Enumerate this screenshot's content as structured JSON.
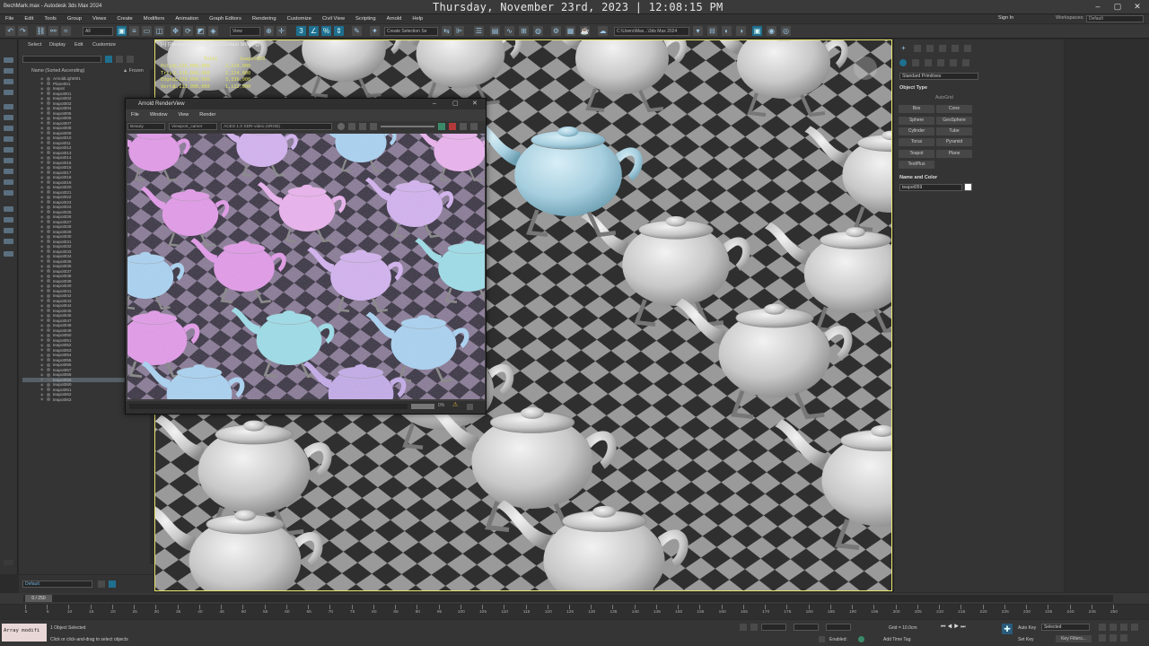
{
  "window": {
    "title": "BechMark.max - Autodesk 3ds Max 2024",
    "clock": "Thursday, November 23rd, 2023 | 12:08:15 PM"
  },
  "menubar": [
    "File",
    "Edit",
    "Tools",
    "Group",
    "Views",
    "Create",
    "Modifiers",
    "Animation",
    "Graph Editors",
    "Rendering",
    "Customize",
    "Civil View",
    "Scripting",
    "Arnold",
    "Help"
  ],
  "account": {
    "sign_in": "Sign In",
    "workspaces_label": "Workspaces:",
    "workspace": "Default"
  },
  "toolbar": {
    "filter": "All",
    "view": "View",
    "selection_set": "Create Selection Se",
    "path": "C:\\Users\\Max...\\3ds Max 2024"
  },
  "explorer": {
    "tabs": [
      "Select",
      "Display",
      "Edit",
      "Customize"
    ],
    "header_name": "Name (Sorted Ascending)",
    "header_frozen": "▲ Frozen",
    "items": [
      "ArnoldLight001",
      "Plane001",
      "teapot",
      "teapot001",
      "teapot002",
      "teapot003",
      "teapot004",
      "teapot005",
      "teapot006",
      "teapot007",
      "teapot008",
      "teapot009",
      "teapot010",
      "teapot011",
      "teapot012",
      "teapot013",
      "teapot014",
      "teapot015",
      "teapot016",
      "teapot017",
      "teapot018",
      "teapot019",
      "teapot020",
      "teapot021",
      "teapot022",
      "teapot023",
      "teapot024",
      "teapot025",
      "teapot026",
      "teapot027",
      "teapot028",
      "teapot029",
      "teapot030",
      "teapot031",
      "teapot032",
      "teapot033",
      "teapot034",
      "teapot035",
      "teapot036",
      "teapot037",
      "teapot038",
      "teapot039",
      "teapot040",
      "teapot041",
      "teapot042",
      "teapot043",
      "teapot044",
      "teapot045",
      "teapot046",
      "teapot047",
      "teapot048",
      "teapot049",
      "teapot050",
      "teapot051",
      "teapot052",
      "teapot053",
      "teapot054",
      "teapot055",
      "teapot056",
      "teapot057",
      "teapot058",
      "teapot059",
      "teapot060",
      "teapot061",
      "teapot062",
      "teapot063"
    ],
    "selected_item": "teapot059",
    "layer": "Default"
  },
  "viewport": {
    "label": "[+] [Perspective] [Standard] [Default Shading]",
    "stats": {
      "header": [
        "Total",
        "teapot059"
      ],
      "polys": [
        "Polys:",
        "2,226,000,000",
        "2,224,000"
      ],
      "tris": [
        "Tris:",
        "2,226,000,000",
        "2,224,000"
      ],
      "edges": [
        "Edges:",
        "3,338,000,000",
        "3,336,000"
      ],
      "verts": [
        "Verts:",
        "1,113,000,000",
        "1,112,000"
      ]
    }
  },
  "render_view": {
    "title": "Arnold RenderView",
    "menu": [
      "File",
      "Window",
      "View",
      "Render"
    ],
    "pass": "Beauty",
    "camera": "Viewport_camer",
    "view_transform": "ACES 1.0 SDR-video (sRGB)",
    "zoom": "0%"
  },
  "command_panel": {
    "dropdown": "Standard Primitives",
    "object_type_title": "Object Type",
    "autogrid": "AutoGrid",
    "buttons": [
      "Box",
      "Cone",
      "Sphere",
      "GeoSphere",
      "Cylinder",
      "Tube",
      "Torus",
      "Pyramid",
      "Teapot",
      "Plane",
      "TextPlus"
    ],
    "name_color_title": "Name and Color",
    "object_name": "teapot059"
  },
  "timeline": {
    "frame": "0 / 250",
    "ticks": [
      "0",
      "5",
      "10",
      "15",
      "20",
      "25",
      "30",
      "35",
      "40",
      "45",
      "50",
      "55",
      "60",
      "65",
      "70",
      "75",
      "80",
      "85",
      "90",
      "95",
      "100",
      "105",
      "110",
      "115",
      "120",
      "125",
      "130",
      "135",
      "140",
      "145",
      "150",
      "155",
      "160",
      "165",
      "170",
      "175",
      "180",
      "185",
      "190",
      "195",
      "200",
      "205",
      "210",
      "215",
      "220",
      "225",
      "230",
      "235",
      "240",
      "245",
      "250"
    ]
  },
  "status": {
    "maxscript": "Array modifi",
    "selected": "1 Object Selected",
    "prompt": "Click or click-and-drag to select objects",
    "grid": "Grid = 10.0cm",
    "enabled": "Enabled:",
    "add_time_tag": "Add Time Tag",
    "auto_key": "Auto Key",
    "set_key": "Set Key",
    "selected_dd": "Selected",
    "key_filters": "Key Filters..."
  },
  "colors": {
    "accent": "#1f6f8f",
    "viewport_border": "#e7e36a",
    "selected_teapot": "#a7cfdf"
  }
}
